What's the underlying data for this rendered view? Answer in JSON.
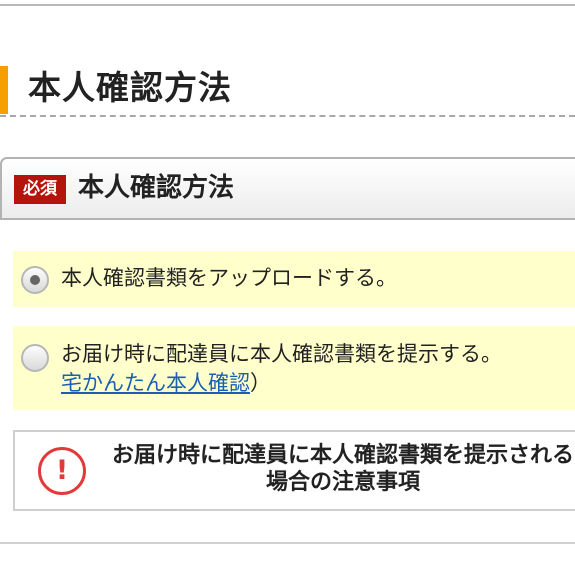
{
  "heading": {
    "title": "本人確認方法"
  },
  "section": {
    "required_badge": "必須",
    "title": "本人確認方法"
  },
  "options": [
    {
      "label": "本人確認書類をアップロードする。",
      "selected": true
    },
    {
      "label": "お届け時に配達員に本人確認書類を提示する。",
      "link_text": "宅かんたん本人確認",
      "link_suffix": "）",
      "selected": false
    }
  ],
  "notice": {
    "text": "お届け時に配達員に本人確認書類を提示される場合の注意事項",
    "icon": "alert-circle-icon"
  },
  "colors": {
    "accent": "#f5a000",
    "required": "#b3150d",
    "option_bg": "#ffffcc",
    "link": "#1a5fb4",
    "alert": "#e23a3a"
  }
}
